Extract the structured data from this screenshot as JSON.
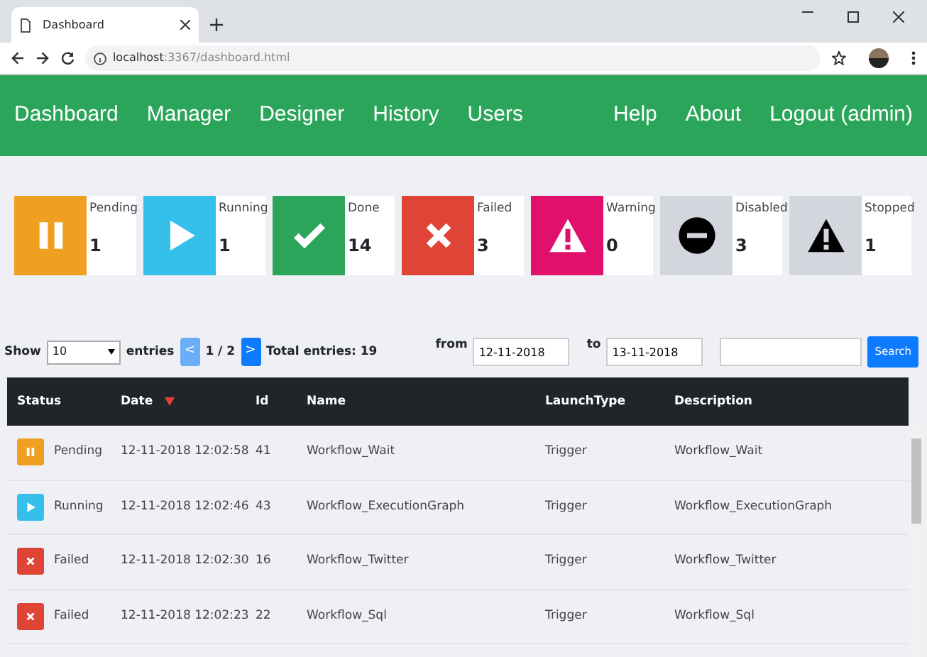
{
  "browser": {
    "tab_title": "Dashboard",
    "url": "**localhost**:3367/dashboard.html"
  },
  "navbar": {
    "left": [
      "Dashboard",
      "Manager",
      "Designer",
      "History",
      "Users"
    ],
    "right": [
      "Help",
      "About",
      "Logout (admin)"
    ]
  },
  "status_tiles": [
    {
      "kind": "pending",
      "label": "Pending",
      "count": "1"
    },
    {
      "kind": "running",
      "label": "Running",
      "count": "1"
    },
    {
      "kind": "done",
      "label": "Done",
      "count": "14"
    },
    {
      "kind": "failed",
      "label": "Failed",
      "count": "3"
    },
    {
      "kind": "warning",
      "label": "Warning",
      "count": "0"
    },
    {
      "kind": "disabled",
      "label": "Disabled",
      "count": "3"
    },
    {
      "kind": "stopped",
      "label": "Stopped",
      "count": "1"
    }
  ],
  "toolbar": {
    "show_label": "Show",
    "page_size": "10",
    "entries_label": "entries",
    "prev": {
      "label": "<",
      "disabled": true
    },
    "page": "1 / 2",
    "next": {
      "label": ">",
      "disabled": false
    },
    "total": "Total entries: 19",
    "from_label": "from",
    "from": "12-11-2018",
    "to_label": "to",
    "to": "13-11-2018",
    "search_button": "Search"
  },
  "table": {
    "columns": [
      {
        "label": "Status",
        "sorted": false
      },
      {
        "label": "Date",
        "sorted": true
      },
      {
        "label": "Id",
        "sorted": false
      },
      {
        "label": "Name",
        "sorted": false
      },
      {
        "label": "LaunchType",
        "sorted": false
      },
      {
        "label": "Description",
        "sorted": false
      }
    ],
    "rows": [
      {
        "kind": "pending",
        "status": "Pending",
        "date": "12-11-2018 12:02:58",
        "id": "41",
        "name": "Workflow_Wait",
        "launch_type": "Trigger",
        "description": "Workflow_Wait"
      },
      {
        "kind": "running",
        "status": "Running",
        "date": "12-11-2018 12:02:46",
        "id": "43",
        "name": "Workflow_ExecutionGraph",
        "launch_type": "Trigger",
        "description": "Workflow_ExecutionGraph"
      },
      {
        "kind": "failed",
        "status": "Failed",
        "date": "12-11-2018 12:02:30",
        "id": "16",
        "name": "Workflow_Twitter",
        "launch_type": "Trigger",
        "description": "Workflow_Twitter"
      },
      {
        "kind": "failed",
        "status": "Failed",
        "date": "12-11-2018 12:02:23",
        "id": "22",
        "name": "Workflow_Sql",
        "launch_type": "Trigger",
        "description": "Workflow_Sql"
      }
    ]
  }
}
